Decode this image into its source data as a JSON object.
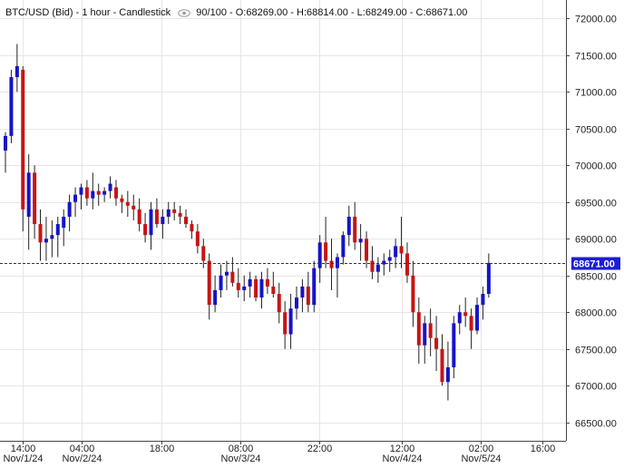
{
  "header": {
    "instrument": "BTC/USD (Bid) - 1 hour - Candlestick",
    "scroll": "90/100",
    "ohlc": "O:68269.00 - H:68814.00 - L:68249.00 - C:68671.00",
    "view_icon": "eye-icon"
  },
  "colors": {
    "up": "#1414c8",
    "down": "#c81414",
    "grid": "#e6e6e6",
    "axis": "#444444",
    "current_bg": "#1d1dd6",
    "current_text": "#ffffff"
  },
  "chart_data": {
    "type": "candlestick",
    "title": "BTC/USD (Bid) - 1 hour - Candlestick",
    "ylim": [
      66250,
      72250
    ],
    "y_ticks": [
      "72000.00",
      "71500.00",
      "71000.00",
      "70500.00",
      "70000.00",
      "69500.00",
      "69000.00",
      "68500.00",
      "68000.00",
      "67500.00",
      "67000.00",
      "66500.00"
    ],
    "x_ticks": [
      {
        "time": "14:00",
        "date": "Nov/1/24"
      },
      {
        "time": "04:00",
        "date": "Nov/2/24"
      },
      {
        "time": "18:00",
        "date": ""
      },
      {
        "time": "08:00",
        "date": "Nov/3/24"
      },
      {
        "time": "22:00",
        "date": ""
      },
      {
        "time": "12:00",
        "date": "Nov/4/24"
      },
      {
        "time": "02:00",
        "date": "Nov/5/24"
      },
      {
        "time": "16:00",
        "date": ""
      }
    ],
    "current_price": "68671.00",
    "current_value": 68671,
    "candles": [
      [
        70200,
        70450,
        69900,
        70400
      ],
      [
        70400,
        71300,
        70300,
        71200
      ],
      [
        71200,
        71650,
        71000,
        71350
      ],
      [
        71300,
        71350,
        69100,
        69400
      ],
      [
        69300,
        70150,
        68850,
        69900
      ],
      [
        69900,
        70000,
        69000,
        69200
      ],
      [
        69200,
        69400,
        68700,
        68950
      ],
      [
        68950,
        69300,
        68700,
        69000
      ],
      [
        69000,
        69250,
        68750,
        69050
      ],
      [
        69050,
        69300,
        68750,
        69200
      ],
      [
        69150,
        69400,
        68900,
        69300
      ],
      [
        69300,
        69600,
        69100,
        69500
      ],
      [
        69500,
        69700,
        69300,
        69600
      ],
      [
        69600,
        69750,
        69400,
        69700
      ],
      [
        69700,
        69800,
        69450,
        69550
      ],
      [
        69550,
        69900,
        69400,
        69650
      ],
      [
        69650,
        69750,
        69450,
        69600
      ],
      [
        69600,
        69700,
        69500,
        69650
      ],
      [
        69650,
        69850,
        69550,
        69750
      ],
      [
        69700,
        69800,
        69450,
        69550
      ],
      [
        69550,
        69600,
        69350,
        69500
      ],
      [
        69500,
        69650,
        69300,
        69450
      ],
      [
        69450,
        69600,
        69250,
        69400
      ],
      [
        69400,
        69550,
        69100,
        69200
      ],
      [
        69200,
        69350,
        68950,
        69050
      ],
      [
        69050,
        69500,
        68850,
        69400
      ],
      [
        69400,
        69550,
        69150,
        69200
      ],
      [
        69200,
        69400,
        69000,
        69300
      ],
      [
        69300,
        69500,
        69200,
        69400
      ],
      [
        69400,
        69500,
        69250,
        69350
      ],
      [
        69350,
        69450,
        69200,
        69300
      ],
      [
        69300,
        69400,
        69150,
        69200
      ],
      [
        69200,
        69250,
        69000,
        69100
      ],
      [
        69100,
        69200,
        68800,
        68900
      ],
      [
        68900,
        69000,
        68600,
        68700
      ],
      [
        68700,
        68800,
        67900,
        68100
      ],
      [
        68100,
        68500,
        68000,
        68300
      ],
      [
        68300,
        68650,
        68200,
        68500
      ],
      [
        68500,
        68700,
        68300,
        68550
      ],
      [
        68550,
        68750,
        68350,
        68400
      ],
      [
        68400,
        68600,
        68200,
        68300
      ],
      [
        68300,
        68500,
        68150,
        68350
      ],
      [
        68350,
        68550,
        68200,
        68450
      ],
      [
        68450,
        68500,
        68150,
        68200
      ],
      [
        68200,
        68550,
        68050,
        68450
      ],
      [
        68450,
        68600,
        68250,
        68350
      ],
      [
        68350,
        68550,
        68200,
        68250
      ],
      [
        68250,
        68400,
        67850,
        68000
      ],
      [
        68000,
        68150,
        67500,
        67700
      ],
      [
        67700,
        68250,
        67500,
        68050
      ],
      [
        68050,
        68350,
        67900,
        68200
      ],
      [
        68200,
        68450,
        68000,
        68350
      ],
      [
        68350,
        68550,
        68000,
        68100
      ],
      [
        68100,
        68700,
        68000,
        68600
      ],
      [
        68600,
        69050,
        68400,
        68950
      ],
      [
        68950,
        69300,
        68600,
        68700
      ],
      [
        68700,
        69000,
        68300,
        68600
      ],
      [
        68600,
        68800,
        68200,
        68750
      ],
      [
        68750,
        69100,
        68650,
        69050
      ],
      [
        69050,
        69450,
        68900,
        69300
      ],
      [
        69300,
        69500,
        68850,
        68950
      ],
      [
        68950,
        69200,
        68700,
        69000
      ],
      [
        69000,
        69100,
        68600,
        68700
      ],
      [
        68700,
        68900,
        68450,
        68550
      ],
      [
        68550,
        68750,
        68400,
        68650
      ],
      [
        68650,
        68800,
        68500,
        68700
      ],
      [
        68700,
        68850,
        68550,
        68750
      ],
      [
        68750,
        69000,
        68600,
        68900
      ],
      [
        68900,
        69300,
        68600,
        68800
      ],
      [
        68800,
        68950,
        68400,
        68500
      ],
      [
        68500,
        68700,
        67800,
        68000
      ],
      [
        68000,
        68200,
        67300,
        67550
      ],
      [
        67550,
        67950,
        67300,
        67850
      ],
      [
        67850,
        68050,
        67400,
        67650
      ],
      [
        67650,
        67950,
        67200,
        67500
      ],
      [
        67500,
        67700,
        67000,
        67050
      ],
      [
        67050,
        67600,
        66800,
        67250
      ],
      [
        67250,
        67950,
        67100,
        67850
      ],
      [
        67850,
        68100,
        67700,
        68000
      ],
      [
        68000,
        68200,
        67800,
        67950
      ],
      [
        67950,
        68050,
        67500,
        67750
      ],
      [
        67750,
        68200,
        67700,
        68100
      ],
      [
        68100,
        68350,
        67900,
        68250
      ],
      [
        68250,
        68800,
        68200,
        68671
      ]
    ]
  }
}
